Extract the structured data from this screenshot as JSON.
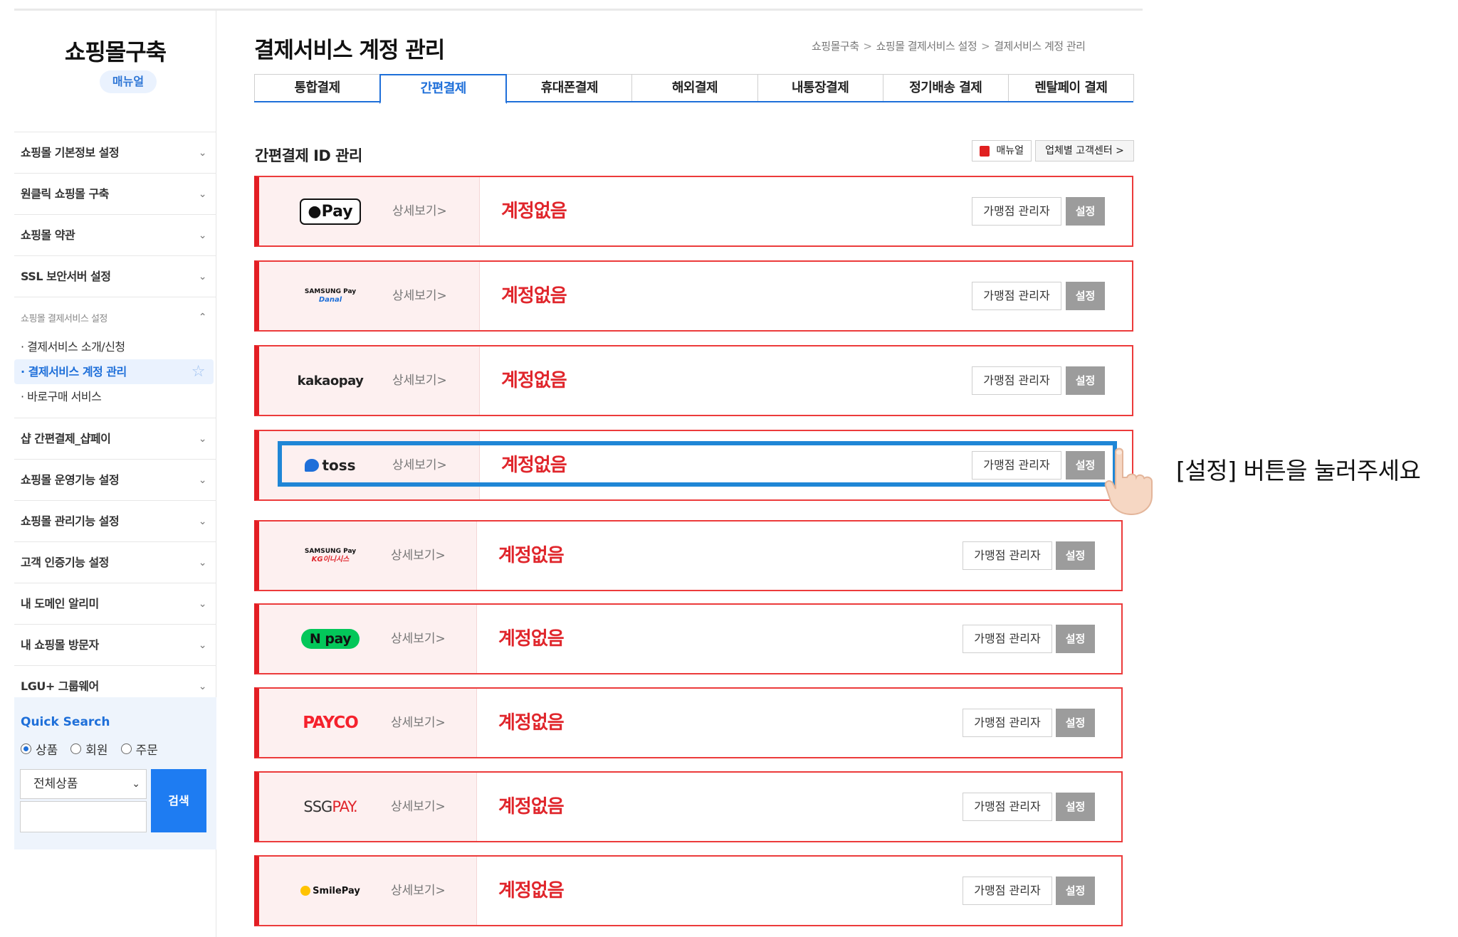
{
  "sidebar": {
    "brand": "쇼핑몰구축",
    "manual_badge": "매뉴얼",
    "menu": [
      "쇼핑몰 기본정보 설정",
      "원클릭 쇼핑몰 구축",
      "쇼핑몰 약관",
      "SSL 보안서버 설정"
    ],
    "open_group": {
      "title": "쇼핑몰 결제서비스 설정",
      "items": [
        "· 결제서비스 소개/신청",
        "· 결제서비스 계정 관리",
        "· 바로구매 서비스"
      ]
    },
    "menu_after": [
      "샵 간편결제_샵페이",
      "쇼핑몰 운영기능 설정",
      "쇼핑몰 관리기능 설정",
      "고객 인증기능 설정",
      "내 도메인 알리미",
      "내 쇼핑몰 방문자",
      "LGU+ 그룹웨어"
    ],
    "quick_search": {
      "title": "Quick Search",
      "radios": [
        "상품",
        "회원",
        "주문"
      ],
      "selected_radio": "상품",
      "select_value": "전체상품",
      "input_value": "",
      "button": "검색"
    }
  },
  "header": {
    "title": "결제서비스 계정 관리",
    "breadcrumb": [
      "쇼핑몰구축",
      "쇼핑몰 결제서비스 설정",
      "결제서비스 계정 관리"
    ]
  },
  "tabs": [
    "통합결제",
    "간편결제",
    "휴대폰결제",
    "해외결제",
    "내통장결제",
    "정기배송 결제",
    "렌탈페이 결제"
  ],
  "active_tab": "간편결제",
  "section": {
    "title": "간편결제 ID 관리",
    "manual_btn": "매뉴얼",
    "center_btn": "업체별 고객센터 >"
  },
  "payments": [
    {
      "logo": "Pay",
      "logo_icon": "apple-icon",
      "detail": "상세보기>",
      "status": "계정없음",
      "admin": "가맹점 관리자",
      "set": "설정"
    },
    {
      "logo": "SAMSUNG Pay",
      "logo_sub": "Danal",
      "detail": "상세보기>",
      "status": "계정없음",
      "admin": "가맹점 관리자",
      "set": "설정"
    },
    {
      "logo": "kakaopay",
      "detail": "상세보기>",
      "status": "계정없음",
      "admin": "가맹점 관리자",
      "set": "설정"
    },
    {
      "logo": "toss",
      "detail": "상세보기>",
      "status": "계정없음",
      "admin": "가맹점 관리자",
      "set": "설정"
    },
    {
      "logo": "SAMSUNG Pay",
      "logo_sub": "KG이니시스",
      "detail": "상세보기>",
      "status": "계정없음",
      "admin": "가맹점 관리자",
      "set": "설정"
    },
    {
      "logo": "pay",
      "logo_prefix": "N",
      "detail": "상세보기>",
      "status": "계정없음",
      "admin": "가맹점 관리자",
      "set": "설정"
    },
    {
      "logo": "PAYCO",
      "detail": "상세보기>",
      "status": "계정없음",
      "admin": "가맹점 관리자",
      "set": "설정"
    },
    {
      "logo": "SSG",
      "logo_suffix": "PAY.",
      "detail": "상세보기>",
      "status": "계정없음",
      "admin": "가맹점 관리자",
      "set": "설정"
    },
    {
      "logo": "SmilePay",
      "detail": "상세보기>",
      "status": "계정없음",
      "admin": "가맹점 관리자",
      "set": "설정"
    }
  ],
  "annotation": {
    "instruction": "[설정] 버튼을 눌러주세요",
    "highlight_color": "#1f86d6"
  },
  "colors": {
    "accent": "#1e6fd9",
    "status_red": "#e0262c",
    "row_border": "#ec3b3b"
  }
}
